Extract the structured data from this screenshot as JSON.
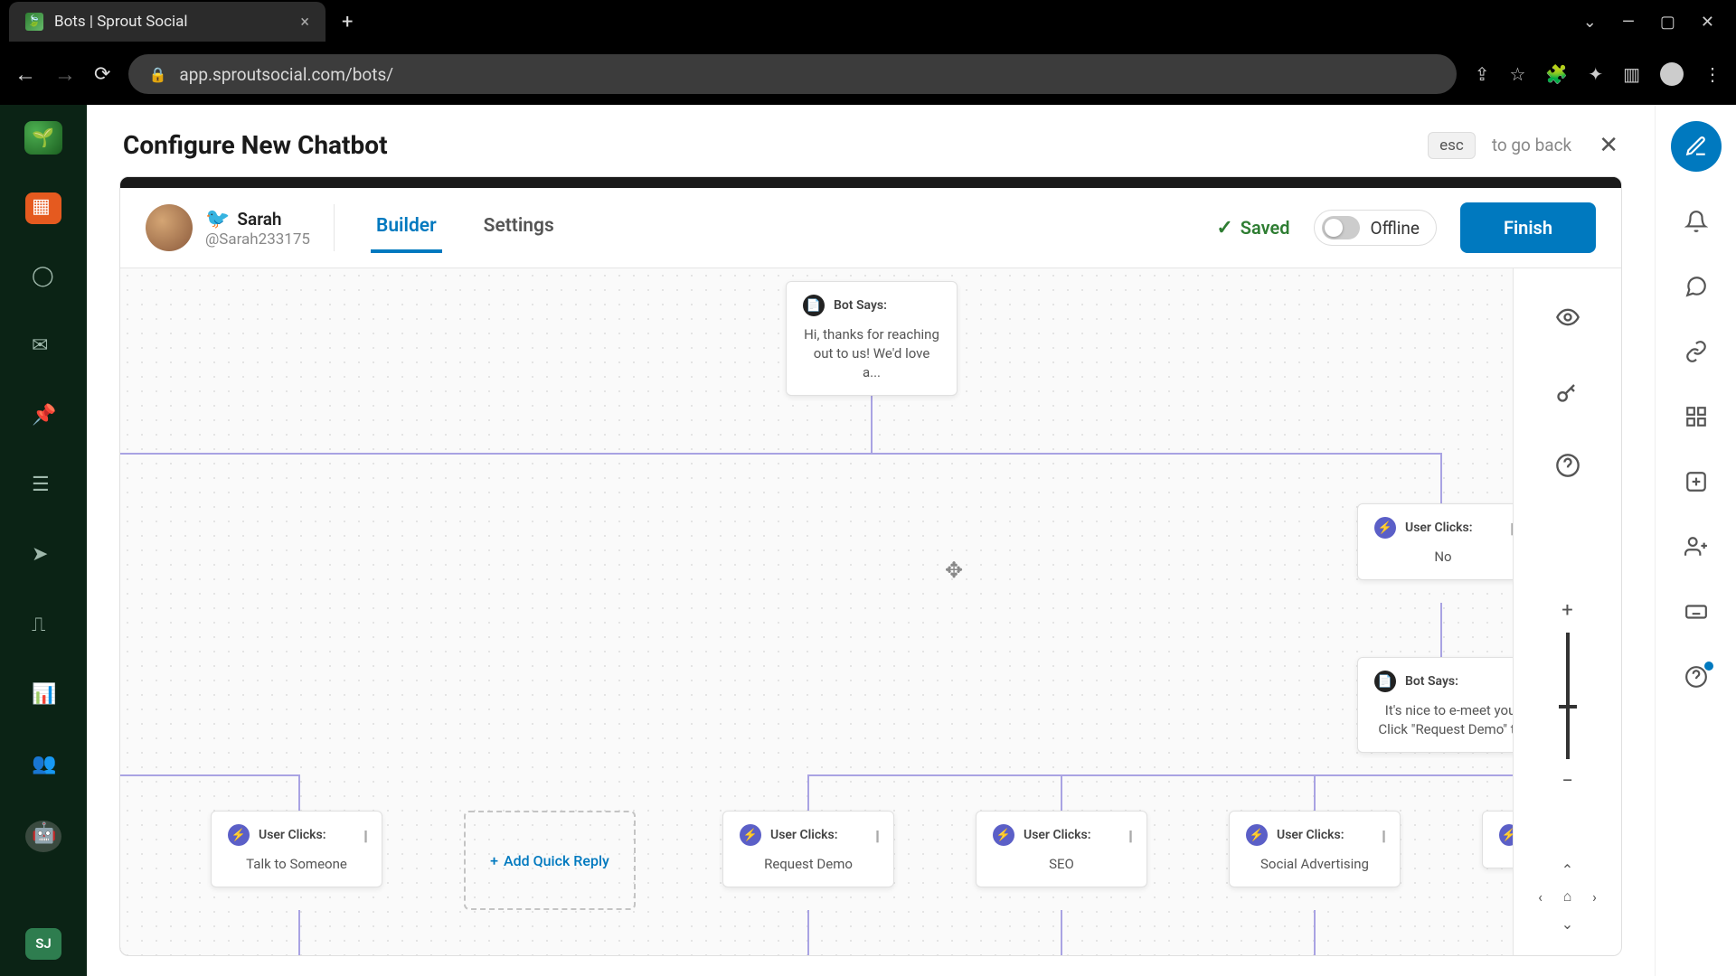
{
  "browser": {
    "tab_title": "Bots | Sprout Social",
    "url": "app.sproutsocial.com/bots/"
  },
  "header": {
    "title": "Configure New Chatbot",
    "esc_label": "esc",
    "go_back_label": "to go back"
  },
  "account": {
    "name": "Sarah",
    "handle": "@Sarah233175"
  },
  "tabs": {
    "builder": "Builder",
    "settings": "Settings"
  },
  "toolbar": {
    "saved_label": "Saved",
    "offline_label": "Offline",
    "finish_label": "Finish"
  },
  "nodes": {
    "bot1_label": "Bot Says:",
    "bot1_text": "Hi, thanks for reaching out to us! We'd love a...",
    "user_clicks_label": "User Clicks:",
    "no_value": "No",
    "bot2_label": "Bot Says:",
    "bot2_text": "It's nice to e-meet you! Click \"Request Demo\" t...",
    "talk": "Talk to Someone",
    "add_quick_reply": "Add Quick Reply",
    "request_demo": "Request Demo",
    "seo": "SEO",
    "social_adv": "Social Advertising"
  },
  "user_badge": "SJ"
}
